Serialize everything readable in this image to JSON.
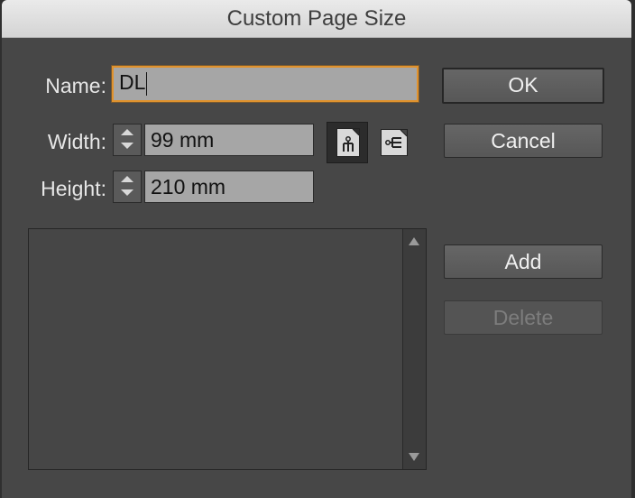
{
  "dialog": {
    "title": "Custom Page Size"
  },
  "form": {
    "name_label": "Name:",
    "name_value": "DL",
    "width_label": "Width:",
    "width_value": "99 mm",
    "height_label": "Height:",
    "height_value": "210 mm",
    "orientation": "portrait"
  },
  "buttons": {
    "ok": "OK",
    "cancel": "Cancel",
    "add": "Add",
    "delete": "Delete",
    "delete_enabled": false
  },
  "icons": {
    "portrait": "portrait-orientation-icon",
    "landscape": "landscape-orientation-icon",
    "stepper_up": "chevron-up-icon",
    "stepper_down": "chevron-down-icon"
  },
  "colors": {
    "focus_ring": "#e0922d",
    "dialog_bg": "#474747",
    "field_bg": "#a6a6a6"
  },
  "page_sizes": []
}
